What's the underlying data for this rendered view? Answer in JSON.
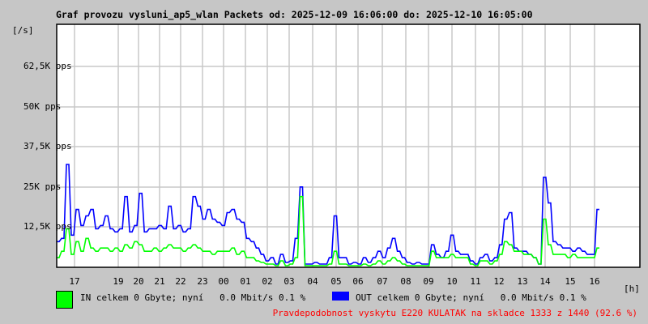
{
  "chart_data": {
    "type": "line",
    "title": "Graf provozu vysluni_ap5_wlan Packets od: 2025-12-09 16:06:00 do: 2025-12-10 16:05:00",
    "ylabel": "[/s]",
    "xlabel": "[h]",
    "ylim": [
      0,
      75.6
    ],
    "y_unit": "K pps",
    "yticks": [
      {
        "value": 12.5,
        "label": "12,5K pps"
      },
      {
        "value": 25,
        "label": "25K pps"
      },
      {
        "value": 37.5,
        "label": "37,5K pps"
      },
      {
        "value": 50,
        "label": "50K pps"
      },
      {
        "value": 62.5,
        "label": "62,5K pps"
      }
    ],
    "xticks": [
      "17",
      "19",
      "20",
      "21",
      "22",
      "23",
      "00",
      "01",
      "02",
      "03",
      "04",
      "05",
      "06",
      "07",
      "08",
      "09",
      "10",
      "11",
      "12",
      "13",
      "14",
      "15",
      "16"
    ],
    "grid": true,
    "series": [
      {
        "name": "OUT",
        "color": "#0000ff",
        "values": [
          8,
          9,
          32,
          10,
          18,
          13,
          16,
          18,
          12,
          13,
          16,
          12,
          11,
          12,
          22,
          11,
          13,
          23,
          11,
          12,
          12,
          13,
          12,
          19,
          12,
          13,
          11,
          12,
          22,
          19,
          15,
          18,
          15,
          14,
          13,
          17,
          18,
          15,
          14,
          9,
          8,
          6,
          4,
          2,
          3,
          1,
          4,
          1.5,
          2,
          9,
          25,
          1,
          1,
          1.5,
          1,
          1,
          3,
          16,
          3,
          3,
          1,
          1.5,
          1,
          3,
          1.5,
          3,
          5,
          3,
          6,
          9,
          5,
          3,
          1.5,
          1,
          1.5,
          1,
          1,
          7,
          4,
          3,
          5,
          10,
          5,
          4,
          4,
          2,
          1,
          3,
          4,
          2,
          3,
          7,
          15,
          17,
          6,
          5,
          5,
          4,
          3,
          1,
          28,
          20,
          8,
          7,
          6,
          6,
          5,
          6,
          5,
          4,
          4,
          18
        ]
      },
      {
        "name": "IN",
        "color": "#00ff00",
        "values": [
          3,
          5,
          12,
          4,
          8,
          5,
          9,
          6,
          5,
          6,
          6,
          5,
          6,
          5,
          7,
          6,
          8,
          7,
          5,
          5,
          6,
          5,
          6,
          7,
          6,
          6,
          5,
          6,
          7,
          6,
          5,
          5,
          4,
          5,
          5,
          5,
          6,
          4,
          5,
          3,
          3,
          2,
          1.5,
          1,
          1,
          0.5,
          2,
          0.5,
          1,
          3,
          22,
          0.5,
          0.5,
          0.5,
          0.5,
          0.5,
          1,
          5,
          1,
          1,
          0.5,
          0.5,
          0.5,
          1,
          0.5,
          1,
          2,
          1,
          2,
          3,
          2,
          1,
          0.5,
          0.5,
          0.5,
          0.5,
          0.5,
          5,
          3,
          3,
          3,
          4,
          3,
          3,
          3,
          1,
          0.5,
          2,
          2,
          1,
          2,
          4,
          8,
          7,
          5,
          5,
          4,
          4,
          3,
          1,
          15,
          7,
          4,
          4,
          4,
          3,
          4,
          3,
          3,
          3,
          3,
          6
        ]
      }
    ],
    "legend": {
      "position": "bottom",
      "in": {
        "text": "IN celkem 0 Gbyte; nyní   0.0 Mbit/s 0.1 %",
        "color": "#00ff00"
      },
      "out": {
        "text": "OUT celkem 0 Gbyte; nyní   0.0 Mbit/s 0.1 %",
        "color": "#0000ff"
      }
    },
    "annotation": {
      "text": "Pravdepodobnost vyskytu E220 KULATAK na skladce 1333 z 1440 (92.6 %)",
      "color": "#ff0000"
    }
  }
}
